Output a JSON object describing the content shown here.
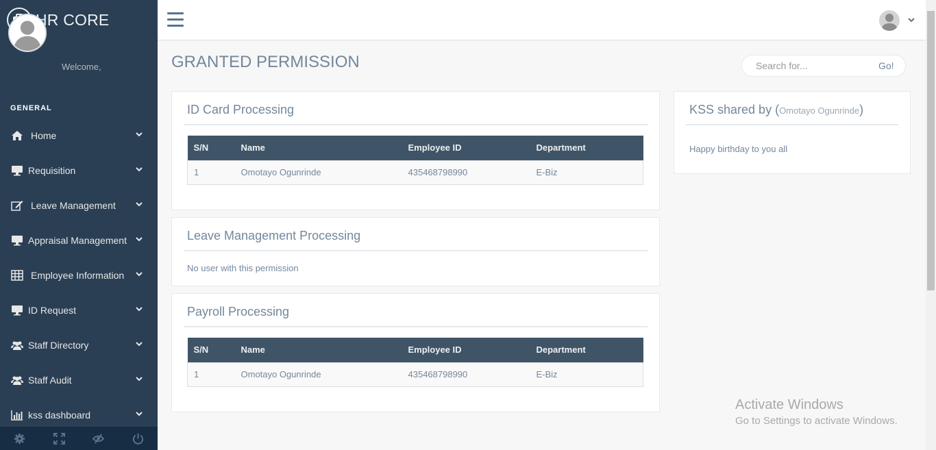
{
  "app": {
    "title": "HR CORE"
  },
  "sidebar": {
    "welcome": "Welcome,",
    "section_title": "GENERAL",
    "items": [
      {
        "label": "Home",
        "icon": "home-icon"
      },
      {
        "label": "Requisition",
        "icon": "desktop-icon"
      },
      {
        "label": "Leave Management",
        "icon": "edit-icon"
      },
      {
        "label": "Appraisal Management",
        "icon": "desktop-icon"
      },
      {
        "label": "Employee Information",
        "icon": "table-icon"
      },
      {
        "label": "ID Request",
        "icon": "desktop-icon"
      },
      {
        "label": "Staff Directory",
        "icon": "users-icon"
      },
      {
        "label": "Staff Audit",
        "icon": "users-icon"
      },
      {
        "label": "kss dashboard",
        "icon": "bar-chart-icon"
      }
    ],
    "footer_icons": [
      "settings-icon",
      "fullscreen-icon",
      "lock-icon",
      "power-icon"
    ]
  },
  "header": {
    "avatar": "user-avatar"
  },
  "page": {
    "title": "GRANTED PERMISSION"
  },
  "search": {
    "placeholder": "Search for...",
    "button": "Go!"
  },
  "panels": {
    "id_card": {
      "title": "ID Card Processing",
      "columns": [
        "S/N",
        "Name",
        "Employee ID",
        "Department"
      ],
      "rows": [
        [
          "1",
          "Omotayo Ogunrinde",
          "435468798990",
          "E-Biz"
        ]
      ]
    },
    "leave": {
      "title": "Leave Management Processing",
      "empty_message": "No user with this permission"
    },
    "payroll": {
      "title": "Payroll Processing",
      "columns": [
        "S/N",
        "Name",
        "Employee ID",
        "Department"
      ],
      "rows": [
        [
          "1",
          "Omotayo Ogunrinde",
          "435468798990",
          "E-Biz"
        ]
      ]
    }
  },
  "kss": {
    "title_prefix": "KSS shared by (",
    "shared_by": "Omotayo Ogunrinde",
    "title_suffix": ")",
    "message": "Happy birthday to you all"
  },
  "watermark": {
    "line1": "Activate Windows",
    "line2": "Go to Settings to activate Windows."
  },
  "colors": {
    "sidebar": "#2a3f54",
    "table_header": "#405467",
    "text": "#73879c"
  }
}
